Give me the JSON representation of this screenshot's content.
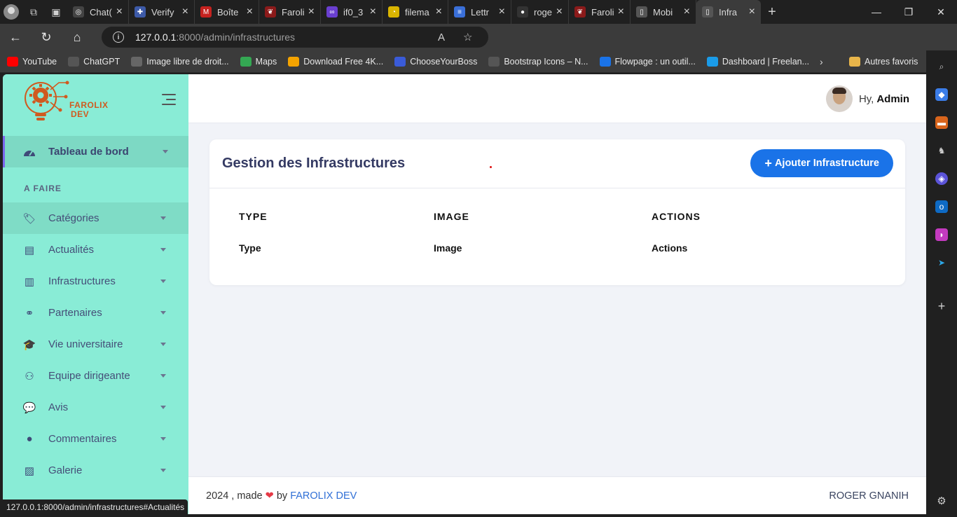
{
  "browser": {
    "tabs": [
      {
        "label": "Chat(",
        "color": "#444",
        "glyph": "◎"
      },
      {
        "label": "Verify",
        "color": "#3d5aa8",
        "glyph": "✚"
      },
      {
        "label": "Boîte",
        "color": "#c5221f",
        "glyph": "M"
      },
      {
        "label": "Faroli",
        "color": "#8b1a1a",
        "glyph": "❦"
      },
      {
        "label": "if0_3",
        "color": "#6a3fd0",
        "glyph": "∞"
      },
      {
        "label": "filema",
        "color": "#d9b400",
        "glyph": "◔"
      },
      {
        "label": "Lettr",
        "color": "#3a6fd8",
        "glyph": "≡"
      },
      {
        "label": "roger",
        "color": "#333",
        "glyph": "●"
      },
      {
        "label": "Faroli",
        "color": "#8b1a1a",
        "glyph": "❦"
      },
      {
        "label": "Mobi",
        "color": "#555",
        "glyph": "▯"
      },
      {
        "label": "Infra",
        "color": "#555",
        "glyph": "▯"
      }
    ],
    "url_host": "127.0.0.1",
    "url_rest": ":8000/admin/infrastructures",
    "bookmarks": [
      {
        "label": "YouTube",
        "color": "#ff0000"
      },
      {
        "label": "ChatGPT",
        "color": "#555"
      },
      {
        "label": "Image libre de droit...",
        "color": "#666"
      },
      {
        "label": "Maps",
        "color": "#34a853"
      },
      {
        "label": "Download Free 4K...",
        "color": "#f4a300"
      },
      {
        "label": "ChooseYourBoss",
        "color": "#3a5bd8"
      },
      {
        "label": "Bootstrap Icons – N...",
        "color": "#555"
      },
      {
        "label": "Flowpage : un outil...",
        "color": "#1a73e8"
      },
      {
        "label": "Dashboard | Freelan...",
        "color": "#1a9be8"
      }
    ],
    "other_bookmarks": "Autres favoris",
    "status_url": "127.0.0.1:8000/admin/infrastructures#Actualités"
  },
  "app": {
    "logo_line1": "FAROLIX",
    "logo_line2": "DEV",
    "greeting": "Hy,",
    "user_name": "Admin",
    "sidebar": {
      "dashboard": "Tableau de bord",
      "section_label": "A FAIRE",
      "items": [
        {
          "label": "Catégories",
          "icon": "tags-icon"
        },
        {
          "label": "Actualités",
          "icon": "newspaper-icon"
        },
        {
          "label": "Infrastructures",
          "icon": "building-icon"
        },
        {
          "label": "Partenaires",
          "icon": "handshake-icon"
        },
        {
          "label": "Vie universitaire",
          "icon": "graduation-cap-icon"
        },
        {
          "label": "Equipe dirigeante",
          "icon": "users-icon"
        },
        {
          "label": "Avis",
          "icon": "comments-icon"
        },
        {
          "label": "Commentaires",
          "icon": "comment-icon"
        },
        {
          "label": "Galerie",
          "icon": "images-icon"
        }
      ]
    },
    "card": {
      "title": "Gestion des Infrastructures",
      "add_button": "Ajouter Infrastructure",
      "columns": [
        "TYPE",
        "IMAGE",
        "ACTIONS"
      ],
      "row": [
        "Type",
        "Image",
        "Actions"
      ]
    },
    "footer": {
      "year_text": "2024 , made",
      "by_text": "by",
      "brand": "FAROLIX DEV",
      "author": "ROGER GNANIH"
    }
  },
  "colors": {
    "sidebar_bg": "#89ecd6",
    "accent": "#1a73e8",
    "title": "#343a63"
  }
}
